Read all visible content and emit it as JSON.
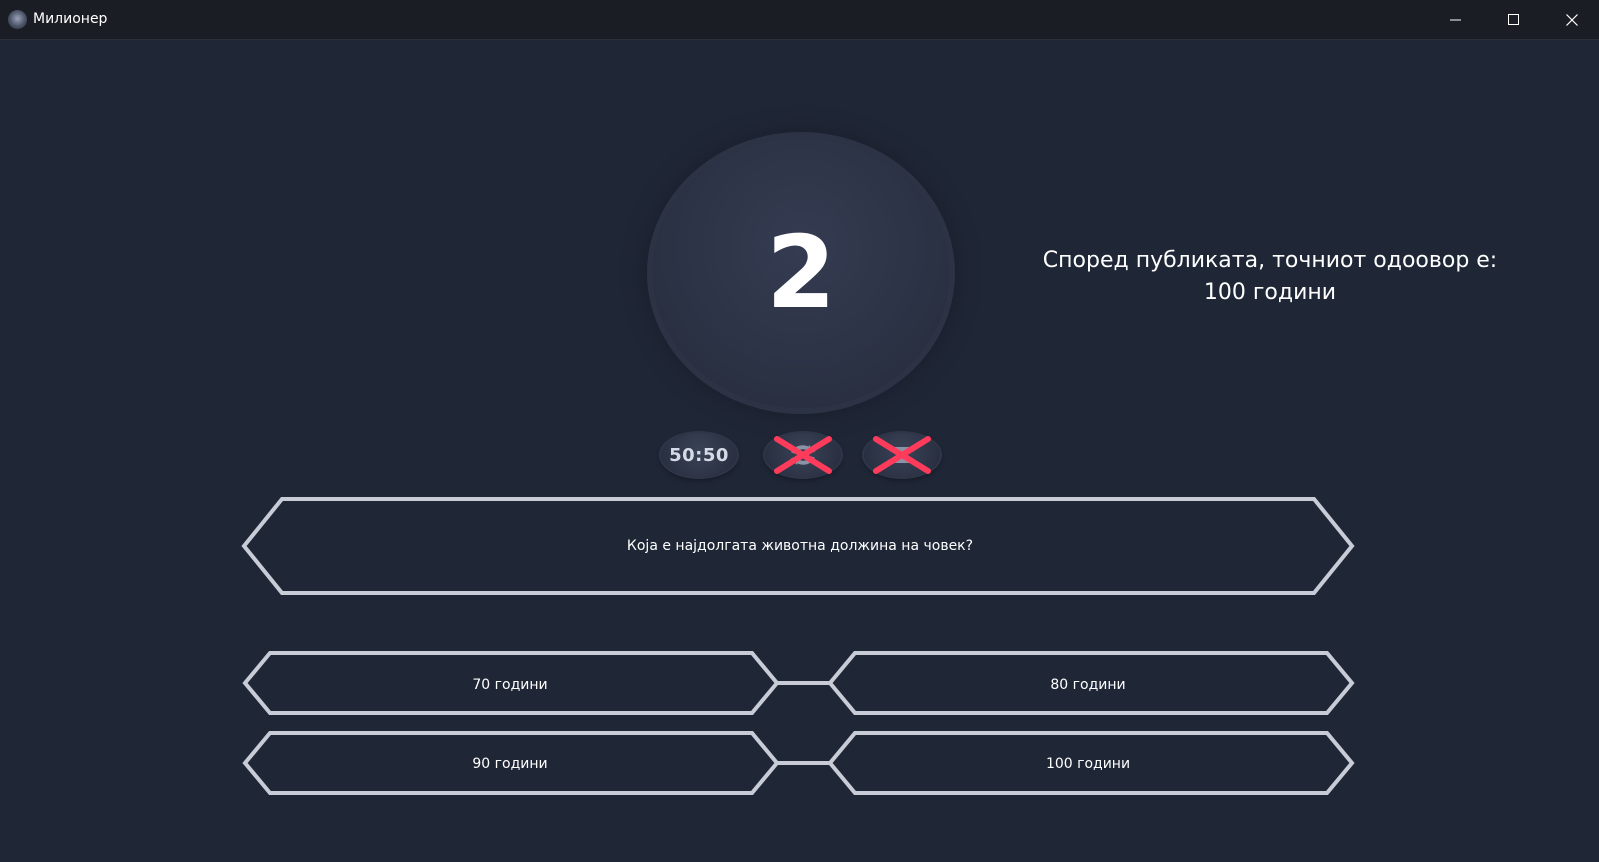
{
  "window": {
    "title": "Милионер",
    "app_icon": "millionaire-logo-icon",
    "controls": {
      "minimize_icon": "minimize-icon",
      "maximize_icon": "maximize-icon",
      "close_icon": "close-icon"
    }
  },
  "game": {
    "timer": "2",
    "audience_message_line1": "Според публиката, точниот одоовор е:",
    "audience_message_line2": "100 години",
    "lifelines": {
      "fifty_fifty": {
        "label": "50:50",
        "used": false
      },
      "switch_question": {
        "icon": "switch-question-icon",
        "used": true
      },
      "phone_friend": {
        "icon": "phone-icon",
        "used": true
      }
    },
    "used_marker_color": "#ff3b5c",
    "question": "Која е најдолгата животна должина на човек?",
    "answers": {
      "a": "70 години",
      "b": "80 години",
      "c": "90 години",
      "d": "100 години"
    }
  },
  "colors": {
    "background": "#1f2636",
    "titlebar": "#1a1d24",
    "frame_stroke": "#c7ccd6"
  }
}
